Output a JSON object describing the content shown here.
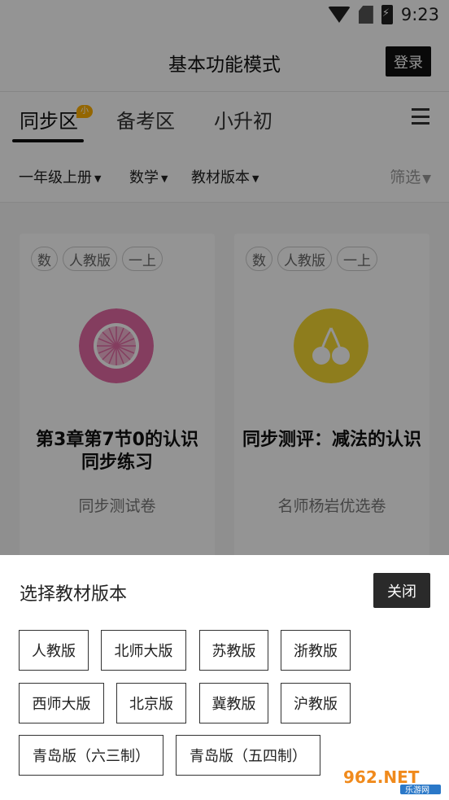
{
  "status_bar": {
    "time": "9:23",
    "icons": [
      "wifi-icon",
      "no-sim-icon",
      "battery-charging-icon"
    ]
  },
  "app_bar": {
    "title": "基本功能模式",
    "login_label": "登录"
  },
  "tabs": [
    {
      "label": "同步区",
      "active": true,
      "badge": "小初高"
    },
    {
      "label": "备考区",
      "active": false
    },
    {
      "label": "小升初",
      "active": false
    }
  ],
  "filters": {
    "grade": "一年级上册",
    "subject": "数学",
    "edition": "教材版本",
    "screen": "筛选"
  },
  "cards": [
    {
      "tags": [
        "数",
        "人教版",
        "一上"
      ],
      "icon": "orange-slice-icon",
      "icon_color": "#e36aa4",
      "title": "第3章第7节0的认识同步练习",
      "subtitle": "同步测试卷"
    },
    {
      "tags": [
        "数",
        "人教版",
        "一上"
      ],
      "icon": "cherry-icon",
      "icon_color": "#f5d832",
      "title": "同步测评：减法的认识",
      "subtitle": "名师杨岩优选卷"
    }
  ],
  "sheet": {
    "title": "选择教材版本",
    "close_label": "关闭",
    "options": [
      "人教版",
      "北师大版",
      "苏教版",
      "浙教版",
      "西师大版",
      "北京版",
      "冀教版",
      "沪教版",
      "青岛版（六三制）",
      "青岛版（五四制）"
    ]
  },
  "watermark": {
    "text": "962.NET",
    "sub": "乐游网"
  }
}
